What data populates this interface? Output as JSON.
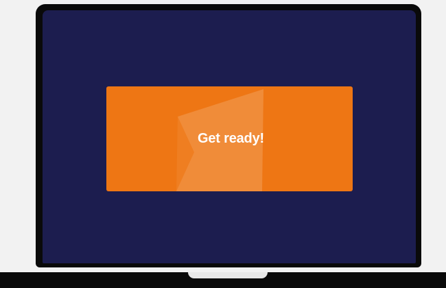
{
  "screen": {
    "background_color": "#1c1d4f"
  },
  "banner": {
    "text": "Get ready!",
    "background_color": "#ee7614",
    "logo_icon": "flag-logo-icon"
  }
}
